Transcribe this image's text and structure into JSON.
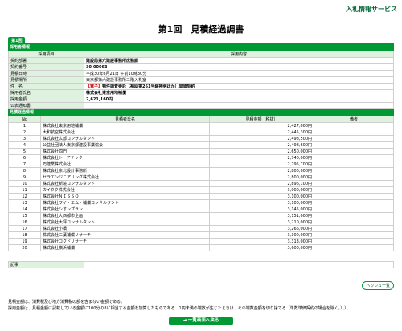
{
  "service_name": "入札情報サービス",
  "title": "第1回　見積経過調書",
  "round_tab": "第1回",
  "adopted_section": {
    "heading": "採用者情報",
    "col_item": "採用項目",
    "col_content": "採用内容",
    "rows": [
      {
        "label": "契約部署",
        "value": "建設局第六建設事務所庶務課"
      },
      {
        "label": "契約番号",
        "value": "30-00063"
      },
      {
        "label": "見積日時",
        "value": "平成30年6月21日 午前10時30分"
      },
      {
        "label": "見積場所",
        "value": "東京都第六建設事務所二階入札室"
      },
      {
        "label": "件　名",
        "value_prefix": "【電子】",
        "value": "物件調査委託（補助第261号線神明ほか）単価契約"
      },
      {
        "label": "採用者氏名",
        "value": "株式会社東京用地補償"
      },
      {
        "label": "採用金額",
        "value": "2,621,160円"
      },
      {
        "label": "公表通知書",
        "value": ""
      }
    ]
  },
  "quote_section": {
    "heading": "見積経過情報",
    "col_no": "No",
    "col_name": "見積者氏名",
    "col_amount": "見積金額（税抜）",
    "col_note": "備考",
    "rows": [
      {
        "no": "1",
        "name": "株式会社東京用地補償",
        "amount": "2,427,000円",
        "note": ""
      },
      {
        "no": "2",
        "name": "大和航空株式会社",
        "amount": "2,445,300円",
        "note": ""
      },
      {
        "no": "3",
        "name": "株式会社広部コンサルタント",
        "amount": "2,498,500円",
        "note": ""
      },
      {
        "no": "4",
        "name": "公益社団法人東京都建設事業協会",
        "amount": "2,498,600円",
        "note": ""
      },
      {
        "no": "5",
        "name": "株式会社四門",
        "amount": "2,650,000円",
        "note": ""
      },
      {
        "no": "6",
        "name": "株式会社トーアテック",
        "amount": "2,740,000円",
        "note": ""
      },
      {
        "no": "7",
        "name": "巧建業株式会社",
        "amount": "2,795,700円",
        "note": ""
      },
      {
        "no": "8",
        "name": "株式会社京北設計事務所",
        "amount": "2,800,000円",
        "note": ""
      },
      {
        "no": "9",
        "name": "セラエンジニアリング株式会社",
        "amount": "2,800,000円",
        "note": ""
      },
      {
        "no": "10",
        "name": "株式会社新境コンサルタント",
        "amount": "2,896,100円",
        "note": ""
      },
      {
        "no": "11",
        "name": "カイタク株式会社",
        "amount": "3,000,000円",
        "note": ""
      },
      {
        "no": "12",
        "name": "株式会社ＮＩＳＳＯ",
        "amount": "3,100,000円",
        "note": ""
      },
      {
        "no": "13",
        "name": "株式会社ワイ・エム・補償コンサルタント",
        "amount": "3,100,000円",
        "note": ""
      },
      {
        "no": "14",
        "name": "株式会社シオンプラン",
        "amount": "3,145,000円",
        "note": ""
      },
      {
        "no": "15",
        "name": "株式会社大西都市企画",
        "amount": "3,151,000円",
        "note": ""
      },
      {
        "no": "16",
        "name": "株式会社大坪コンサルタント",
        "amount": "3,210,000円",
        "note": ""
      },
      {
        "no": "17",
        "name": "株式会社小橋",
        "amount": "3,266,000円",
        "note": ""
      },
      {
        "no": "18",
        "name": "株式会社二葉補償リサーチ",
        "amount": "3,300,000円",
        "note": ""
      },
      {
        "no": "19",
        "name": "株式会社コクドリサーチ",
        "amount": "3,313,000円",
        "note": ""
      },
      {
        "no": "20",
        "name": "株式会社横浜補償",
        "amount": "3,600,000円",
        "note": ""
      }
    ]
  },
  "history_button": "ヘッジュ一覧",
  "remarks_label": "記事",
  "remarks_value": "",
  "notes": [
    "見積金額は、消費税及び地方消費税の額を含まない金額である。",
    "採用金額は、見積金額に記載している金額に100分の8に相当する金額を加算したものである（1円未満の端数が生じたときは、その端数金額を切り捨てる（単数単価契約の場合を除く。）。）。"
  ],
  "back_button": "◄ 一覧画面へ戻る"
}
